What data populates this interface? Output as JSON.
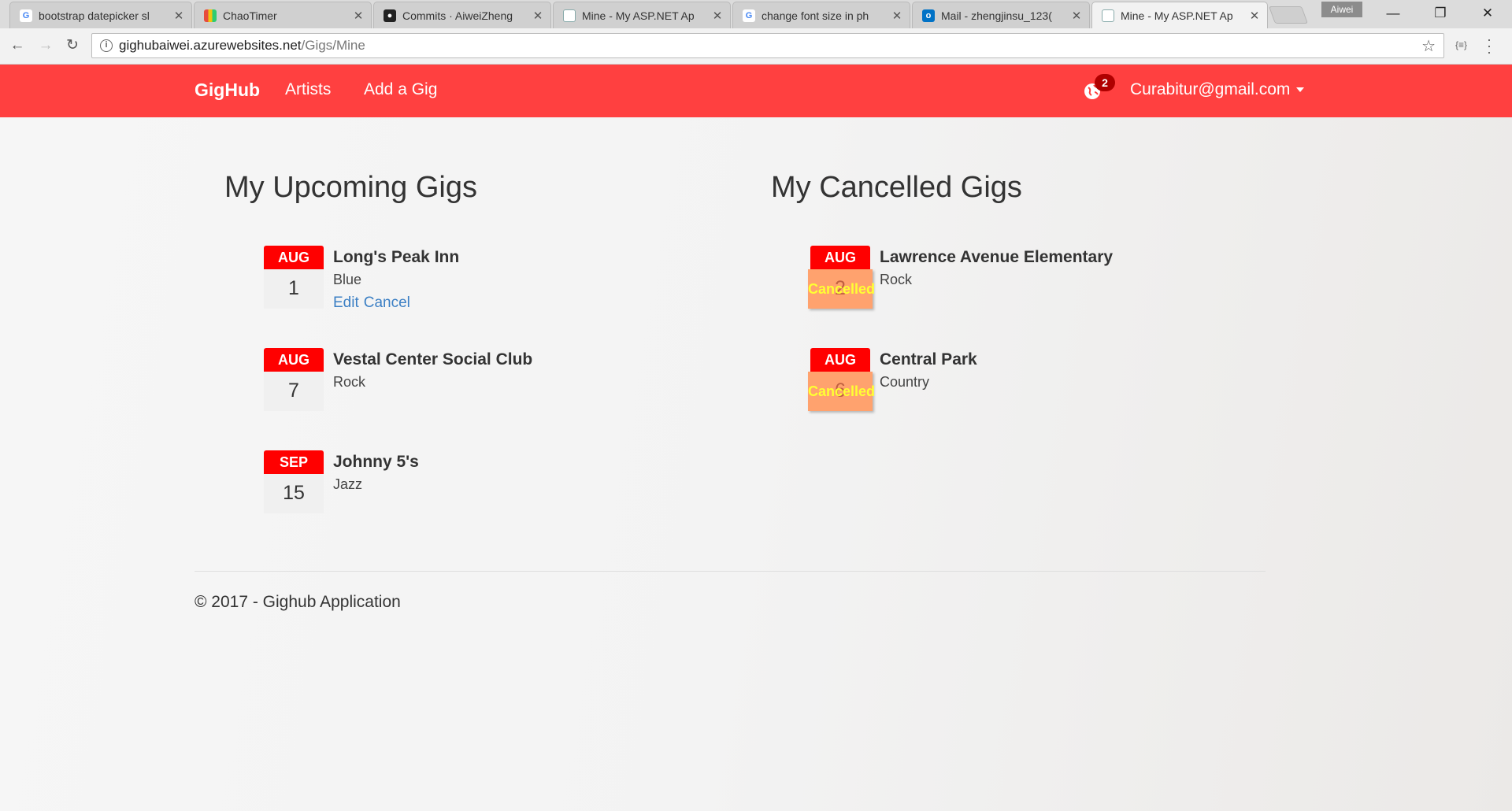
{
  "browser": {
    "tabs": [
      {
        "title": "bootstrap datepicker sl",
        "icon": "google-icon"
      },
      {
        "title": "ChaoTimer",
        "icon": "chaotimer-icon"
      },
      {
        "title": "Commits · AiweiZheng",
        "icon": "github-icon"
      },
      {
        "title": "Mine - My ASP.NET Ap",
        "icon": "document-icon"
      },
      {
        "title": "change font size in ph",
        "icon": "google-icon"
      },
      {
        "title": "Mail - zhengjinsu_123(",
        "icon": "outlook-icon"
      },
      {
        "title": "Mine - My ASP.NET Ap",
        "icon": "document-icon",
        "active": true
      }
    ],
    "profile_name": "Aiwei",
    "url_host": "gighubaiwei.azurewebsites.net",
    "url_path": "/Gigs/Mine"
  },
  "navbar": {
    "brand": "GigHub",
    "links": [
      "Artists",
      "Add a Gig"
    ],
    "notification_count": "2",
    "user_email": "Curabitur@gmail.com"
  },
  "upcoming": {
    "heading": "My Upcoming Gigs",
    "gigs": [
      {
        "month": "AUG",
        "day": "1",
        "venue": "Long's Peak Inn",
        "genre": "Blue",
        "edit_label": "Edit",
        "cancel_label": "Cancel"
      },
      {
        "month": "AUG",
        "day": "7",
        "venue": "Vestal Center Social Club",
        "genre": "Rock"
      },
      {
        "month": "SEP",
        "day": "15",
        "venue": "Johnny 5's",
        "genre": "Jazz"
      }
    ]
  },
  "cancelled": {
    "heading": "My Cancelled Gigs",
    "gigs": [
      {
        "month": "AUG",
        "day": "2",
        "venue": "Lawrence Avenue Elementary",
        "genre": "Rock",
        "status": "Cancelled"
      },
      {
        "month": "AUG",
        "day": "6",
        "venue": "Central Park",
        "genre": "Country",
        "status": "Cancelled"
      }
    ]
  },
  "footer": {
    "text": "© 2017 - Gighub Application"
  },
  "colors": {
    "navbar": "#ff4040",
    "calendar_month": "#ff0000",
    "cancelled_overlay": "#ffa26e",
    "cancelled_text": "#ffff33",
    "link": "#3b7fc4"
  }
}
